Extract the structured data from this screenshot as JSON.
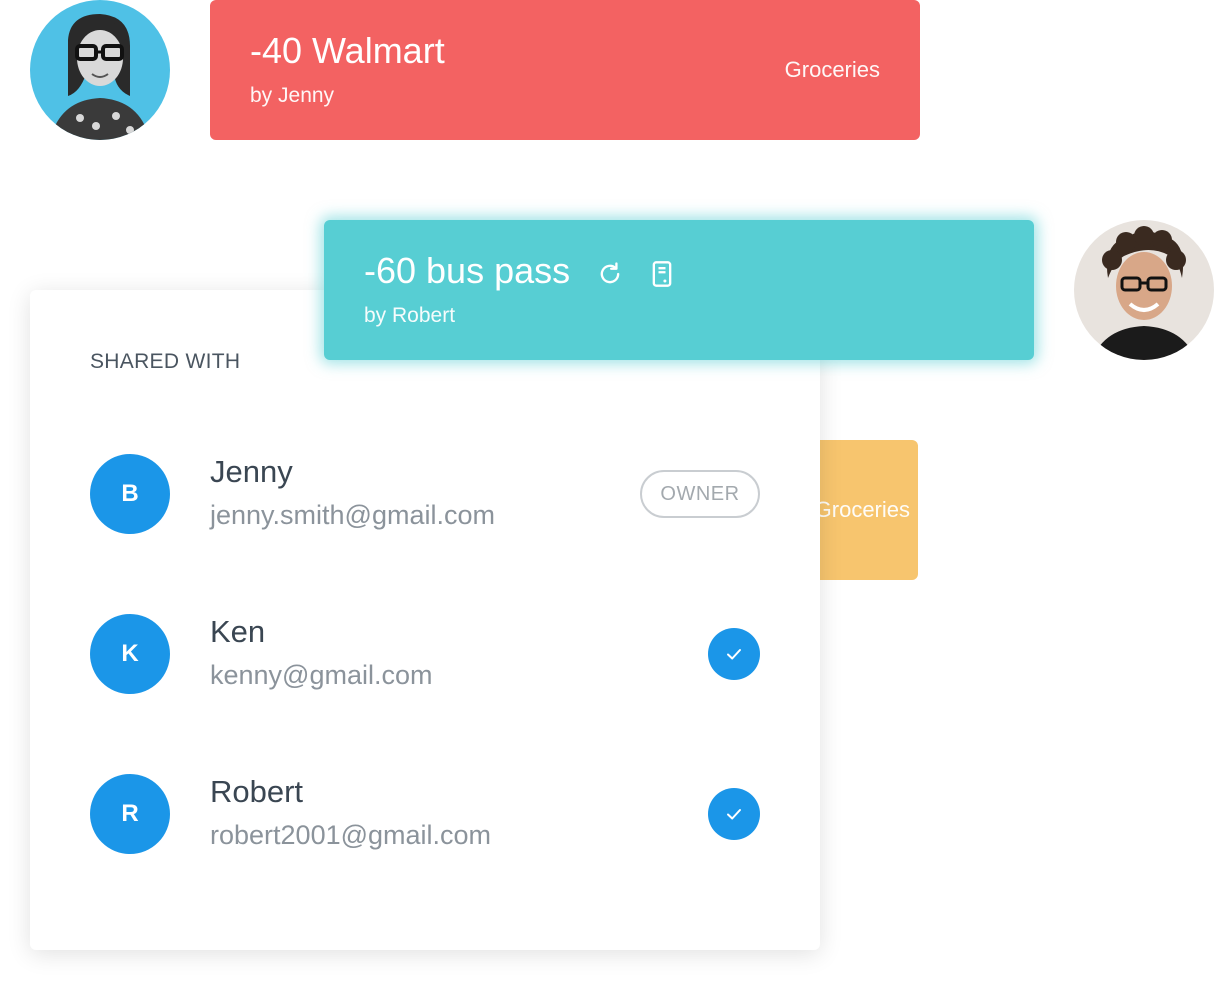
{
  "transactions": {
    "walmart": {
      "amount_title": "-40 Walmart",
      "by": "by Jenny",
      "category": "Groceries",
      "color": "#f36262"
    },
    "bus_pass": {
      "amount_title": "-60 bus pass",
      "by": "by Robert",
      "color": "#57ced3",
      "icons": [
        "refresh-icon",
        "receipt-icon"
      ]
    },
    "partial": {
      "category": "Groceries",
      "color": "#f7c56e"
    }
  },
  "shared_panel": {
    "heading": "SHARED WITH",
    "members": [
      {
        "initial": "B",
        "name": "Jenny",
        "email": "jenny.smith@gmail.com",
        "badge": "OWNER"
      },
      {
        "initial": "K",
        "name": "Ken",
        "email": "kenny@gmail.com",
        "status_icon": "check-icon"
      },
      {
        "initial": "R",
        "name": "Robert",
        "email": "robert2001@gmail.com",
        "status_icon": "check-icon"
      }
    ]
  },
  "colors": {
    "accent": "#1b96e8"
  }
}
